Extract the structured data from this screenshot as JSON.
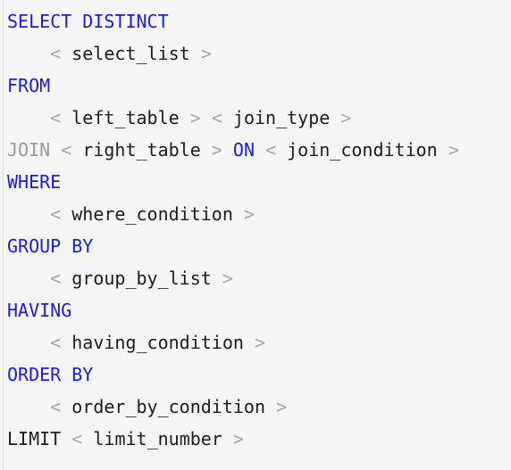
{
  "code_block": {
    "language": "sql",
    "background_color": "#f5f5f5",
    "keyword_color": "#1a1aee",
    "muted_keyword_color": "#9a9a9a",
    "bracket_color": "#a8a8a8",
    "text_color": "#1c1c1c",
    "full_text": "SELECT DISTINCT\n    < select_list >\nFROM\n    < left_table > < join_type >\nJOIN < right_table > ON < join_condition >\nWHERE\n    < where_condition >\nGROUP BY\n    < group_by_list >\nHAVING\n    < having_condition >\nORDER BY\n    < order_by_condition >\nLIMIT < limit_number >",
    "lines": [
      {
        "index": 1,
        "plain": "SELECT DISTINCT",
        "tokens": [
          {
            "text": "SELECT",
            "type": "keyword"
          },
          {
            "text": " ",
            "type": "plain"
          },
          {
            "text": "DISTINCT",
            "type": "keyword"
          }
        ]
      },
      {
        "index": 2,
        "plain": "    < select_list >",
        "tokens": [
          {
            "text": "    ",
            "type": "indent"
          },
          {
            "text": "<",
            "type": "bracket"
          },
          {
            "text": " ",
            "type": "plain"
          },
          {
            "text": "select_list",
            "type": "plain"
          },
          {
            "text": " ",
            "type": "plain"
          },
          {
            "text": ">",
            "type": "bracket"
          }
        ]
      },
      {
        "index": 3,
        "plain": "FROM",
        "tokens": [
          {
            "text": "FROM",
            "type": "keyword"
          }
        ]
      },
      {
        "index": 4,
        "plain": "    < left_table > < join_type >",
        "tokens": [
          {
            "text": "    ",
            "type": "indent"
          },
          {
            "text": "<",
            "type": "bracket"
          },
          {
            "text": " ",
            "type": "plain"
          },
          {
            "text": "left_table",
            "type": "plain"
          },
          {
            "text": " ",
            "type": "plain"
          },
          {
            "text": ">",
            "type": "bracket"
          },
          {
            "text": " ",
            "type": "plain"
          },
          {
            "text": "<",
            "type": "bracket"
          },
          {
            "text": " ",
            "type": "plain"
          },
          {
            "text": "join_type",
            "type": "plain"
          },
          {
            "text": " ",
            "type": "plain"
          },
          {
            "text": ">",
            "type": "bracket"
          }
        ]
      },
      {
        "index": 5,
        "plain": "JOIN < right_table > ON < join_condition >",
        "tokens": [
          {
            "text": "JOIN",
            "type": "keyword-muted"
          },
          {
            "text": " ",
            "type": "plain"
          },
          {
            "text": "<",
            "type": "bracket"
          },
          {
            "text": " ",
            "type": "plain"
          },
          {
            "text": "right_table",
            "type": "plain"
          },
          {
            "text": " ",
            "type": "plain"
          },
          {
            "text": ">",
            "type": "bracket"
          },
          {
            "text": " ",
            "type": "plain"
          },
          {
            "text": "ON",
            "type": "keyword"
          },
          {
            "text": " ",
            "type": "plain"
          },
          {
            "text": "<",
            "type": "bracket"
          },
          {
            "text": " ",
            "type": "plain"
          },
          {
            "text": "join_condition",
            "type": "plain"
          },
          {
            "text": " ",
            "type": "plain"
          },
          {
            "text": ">",
            "type": "bracket"
          }
        ]
      },
      {
        "index": 6,
        "plain": "WHERE",
        "tokens": [
          {
            "text": "WHERE",
            "type": "keyword"
          }
        ]
      },
      {
        "index": 7,
        "plain": "    < where_condition >",
        "tokens": [
          {
            "text": "    ",
            "type": "indent"
          },
          {
            "text": "<",
            "type": "bracket"
          },
          {
            "text": " ",
            "type": "plain"
          },
          {
            "text": "where_condition",
            "type": "plain"
          },
          {
            "text": " ",
            "type": "plain"
          },
          {
            "text": ">",
            "type": "bracket"
          }
        ]
      },
      {
        "index": 8,
        "plain": "GROUP BY",
        "tokens": [
          {
            "text": "GROUP",
            "type": "keyword"
          },
          {
            "text": " ",
            "type": "plain"
          },
          {
            "text": "BY",
            "type": "keyword"
          }
        ]
      },
      {
        "index": 9,
        "plain": "    < group_by_list >",
        "tokens": [
          {
            "text": "    ",
            "type": "indent"
          },
          {
            "text": "<",
            "type": "bracket"
          },
          {
            "text": " ",
            "type": "plain"
          },
          {
            "text": "group_by_list",
            "type": "plain"
          },
          {
            "text": " ",
            "type": "plain"
          },
          {
            "text": ">",
            "type": "bracket"
          }
        ]
      },
      {
        "index": 10,
        "plain": "HAVING",
        "tokens": [
          {
            "text": "HAVING",
            "type": "keyword"
          }
        ]
      },
      {
        "index": 11,
        "plain": "    < having_condition >",
        "tokens": [
          {
            "text": "    ",
            "type": "indent"
          },
          {
            "text": "<",
            "type": "bracket"
          },
          {
            "text": " ",
            "type": "plain"
          },
          {
            "text": "having_condition",
            "type": "plain"
          },
          {
            "text": " ",
            "type": "plain"
          },
          {
            "text": ">",
            "type": "bracket"
          }
        ]
      },
      {
        "index": 12,
        "plain": "ORDER BY",
        "tokens": [
          {
            "text": "ORDER",
            "type": "keyword"
          },
          {
            "text": " ",
            "type": "plain"
          },
          {
            "text": "BY",
            "type": "keyword"
          }
        ]
      },
      {
        "index": 13,
        "plain": "    < order_by_condition >",
        "tokens": [
          {
            "text": "    ",
            "type": "indent"
          },
          {
            "text": "<",
            "type": "bracket"
          },
          {
            "text": " ",
            "type": "plain"
          },
          {
            "text": "order_by_condition",
            "type": "plain"
          },
          {
            "text": " ",
            "type": "plain"
          },
          {
            "text": ">",
            "type": "bracket"
          }
        ]
      },
      {
        "index": 14,
        "plain": "LIMIT < limit_number >",
        "tokens": [
          {
            "text": "LIMIT",
            "type": "plain"
          },
          {
            "text": " ",
            "type": "plain"
          },
          {
            "text": "<",
            "type": "bracket"
          },
          {
            "text": " ",
            "type": "plain"
          },
          {
            "text": "limit_number",
            "type": "plain"
          },
          {
            "text": " ",
            "type": "plain"
          },
          {
            "text": ">",
            "type": "bracket"
          }
        ]
      }
    ]
  }
}
